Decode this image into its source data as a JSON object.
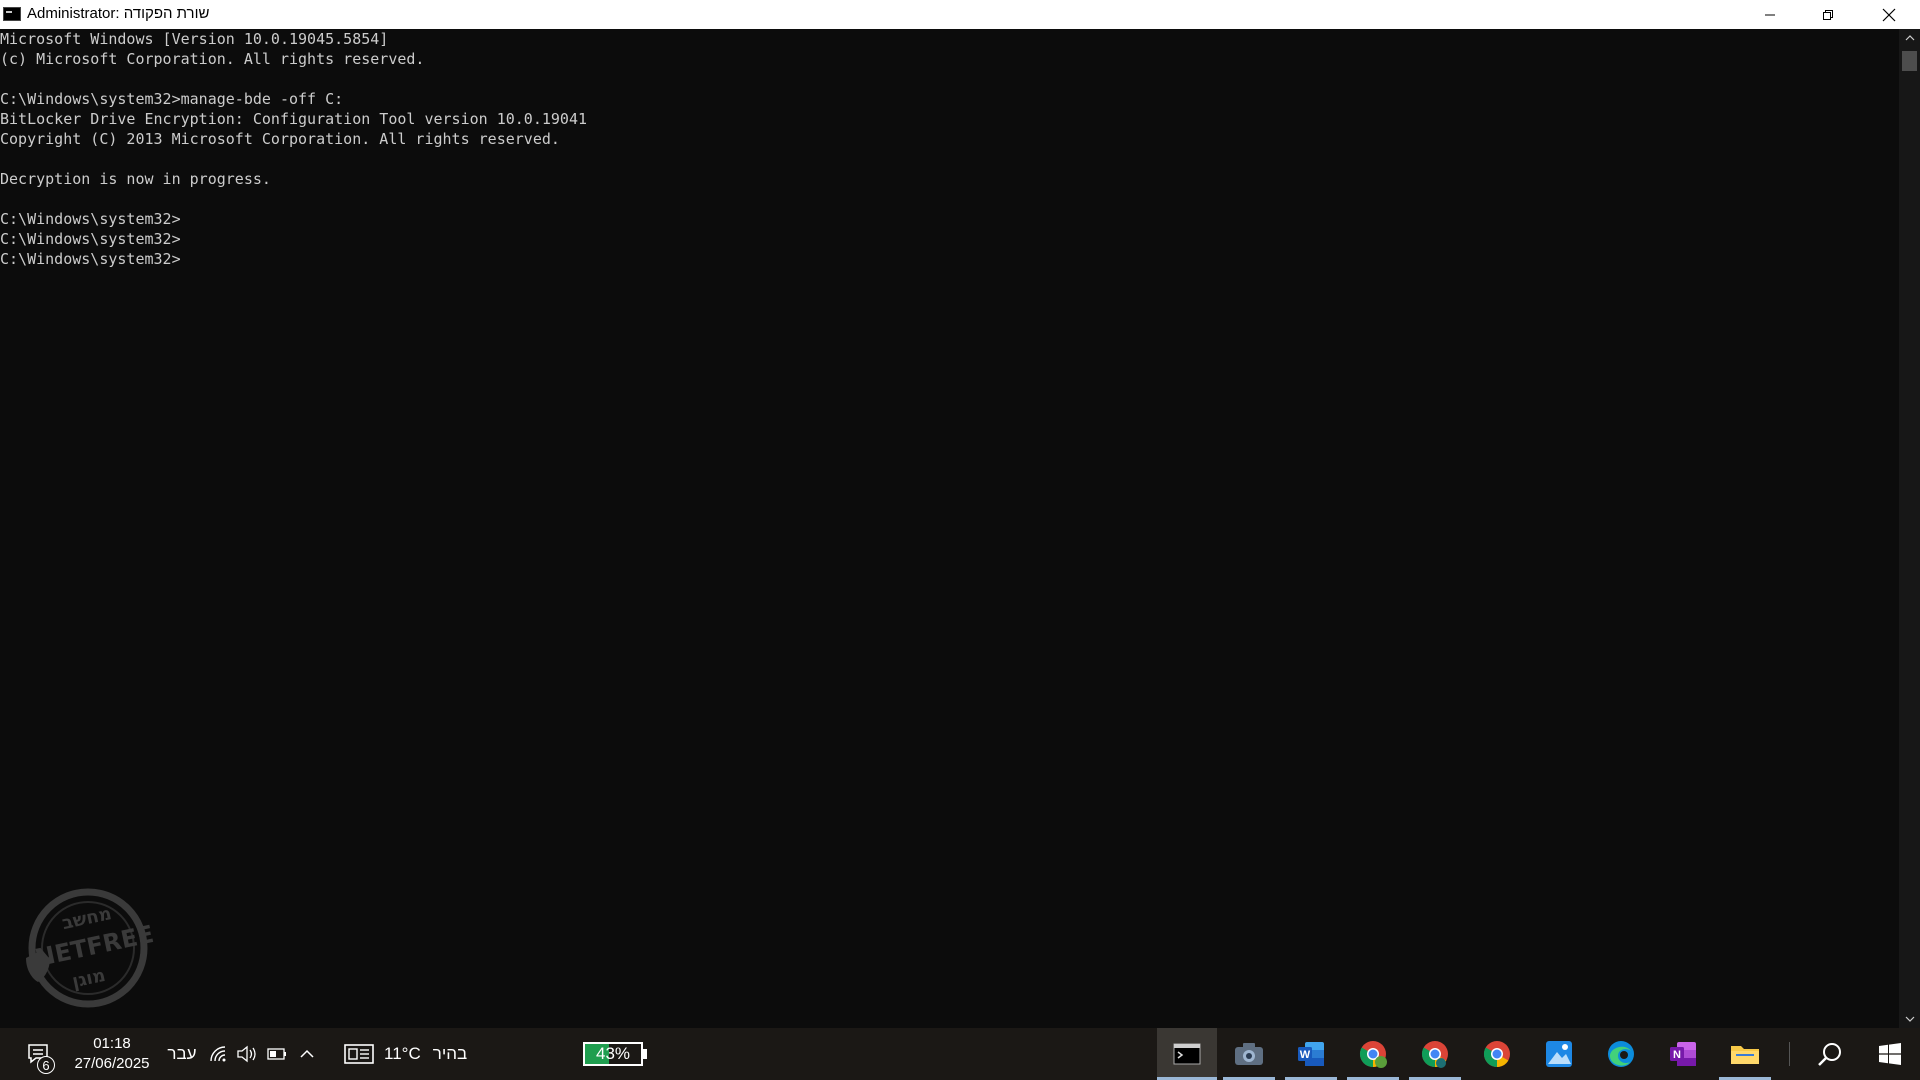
{
  "window": {
    "title": "Administrator: שורת הפקודה",
    "icon": "cmd-icon",
    "controls": [
      "minimize-icon",
      "restore-icon",
      "close-icon"
    ]
  },
  "console": {
    "lines": [
      "Microsoft Windows [Version 10.0.19045.5854]",
      "(c) Microsoft Corporation. All rights reserved.",
      "",
      "C:\\Windows\\system32>manage-bde -off C:",
      "BitLocker Drive Encryption: Configuration Tool version 10.0.19041",
      "Copyright (C) 2013 Microsoft Corporation. All rights reserved.",
      "",
      "Decryption is now in progress.",
      "",
      "C:\\Windows\\system32>",
      "C:\\Windows\\system32>",
      "C:\\Windows\\system32>"
    ],
    "colors": {
      "background": "#0c0c0c",
      "text": "#cccccc"
    }
  },
  "watermark": {
    "top_text": "מחשב",
    "middle_text": "NETFREE",
    "bottom_text": "מוגן"
  },
  "taskbar": {
    "notification_count": "6",
    "clock": {
      "time": "01:18",
      "date": "27/06/2025"
    },
    "language": "עבר",
    "weather": {
      "temp": "11°C",
      "condition": "בהיר"
    },
    "battery": {
      "percent_label": "43%",
      "level": 0.43
    },
    "tray_icons": [
      "network-icon",
      "volume-icon",
      "battery-icon",
      "chevron-up-icon"
    ],
    "apps": [
      {
        "name": "command-prompt",
        "icon": "cmd-icon",
        "state": "active"
      },
      {
        "name": "camera",
        "icon": "camera-icon",
        "state": "running"
      },
      {
        "name": "word",
        "icon": "word-icon",
        "state": "running"
      },
      {
        "name": "chrome-profile-1",
        "icon": "chrome-icon",
        "state": "running"
      },
      {
        "name": "chrome-profile-2",
        "icon": "chrome-icon",
        "state": "running"
      },
      {
        "name": "chrome",
        "icon": "chrome-icon",
        "state": "none"
      },
      {
        "name": "photos",
        "icon": "photos-icon",
        "state": "none"
      },
      {
        "name": "edge",
        "icon": "edge-icon",
        "state": "none"
      },
      {
        "name": "onenote",
        "icon": "onenote-icon",
        "state": "none"
      },
      {
        "name": "file-explorer",
        "icon": "folder-icon",
        "state": "running"
      }
    ],
    "search_icon": "search-icon",
    "start_icon": "windows-logo-icon",
    "accent": "#9ab7d6"
  }
}
